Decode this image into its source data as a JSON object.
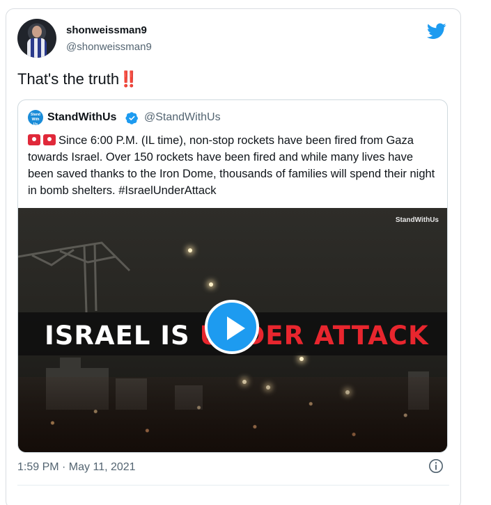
{
  "tweet": {
    "display_name": "shonweissman9",
    "handle": "@shonweissman9",
    "text": "That's the truth",
    "emoji": "‼️",
    "timestamp": "1:59 PM · May 11, 2021"
  },
  "quoted_tweet": {
    "avatar_label": "Stand With Us",
    "display_name": "StandWithUs",
    "verified": true,
    "handle": "@StandWithUs",
    "text": "Since 6:00 P.M. (IL time), non-stop rockets have been fired from Gaza towards Israel. Over 150 rockets have been fired and while many lives have been saved thanks to the Iron Dome, thousands of families will spend their night in bomb shelters. #IsraelUnderAttack",
    "video": {
      "brand": "StandWithUs",
      "banner_white_1": "ISRAEL IS ",
      "banner_red": "UNDER ATTACK"
    }
  },
  "icons": {
    "twitter_logo": "twitter-bird-icon",
    "verified": "verified-badge-icon",
    "info": "info-icon",
    "play": "play-icon"
  },
  "colors": {
    "twitter_blue": "#1d9bf0",
    "banner_red": "#e8262e",
    "muted_text": "#536471"
  }
}
